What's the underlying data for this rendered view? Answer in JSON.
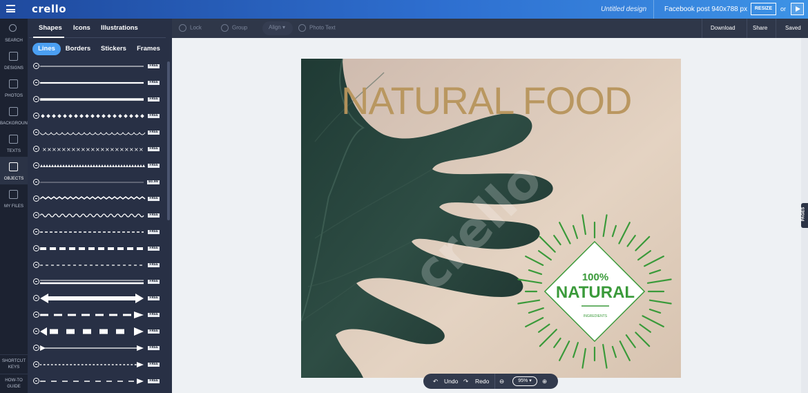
{
  "app": {
    "logo": "crello",
    "title": "Untitled design",
    "size_label": "Facebook post 940x788 px",
    "resize_label": "RESIZE",
    "or_label": "or"
  },
  "rail": {
    "items": [
      {
        "label": "SEARCH",
        "icon": "search-icon"
      },
      {
        "label": "DESIGNS",
        "icon": "designs-icon"
      },
      {
        "label": "PHOTOS",
        "icon": "photos-icon"
      },
      {
        "label": "BACKGROUND",
        "icon": "background-icon"
      },
      {
        "label": "TEXTS",
        "icon": "texts-icon"
      },
      {
        "label": "OBJECTS",
        "icon": "objects-icon"
      },
      {
        "label": "MY FILES",
        "icon": "my-files-icon"
      }
    ],
    "active": "OBJECTS",
    "shortcut_keys": "SHORTCUT KEYS",
    "how_to_guide": "HOW-TO GUIDE"
  },
  "panel": {
    "categories": [
      "Shapes",
      "Icons",
      "Illustrations"
    ],
    "active_category": "Shapes",
    "subtabs": [
      "Lines",
      "Borders",
      "Stickers",
      "Frames"
    ],
    "active_subtab": "Lines",
    "lines": [
      {
        "style": "thin",
        "badge": "FREE"
      },
      {
        "style": "medium",
        "badge": "FREE"
      },
      {
        "style": "thick",
        "badge": "FREE"
      },
      {
        "style": "diamonds",
        "badge": "FREE"
      },
      {
        "style": "scallop",
        "badge": "FREE"
      },
      {
        "style": "crosses",
        "badge": "FREE"
      },
      {
        "style": "triangles",
        "badge": "FREE"
      },
      {
        "style": "hairline",
        "badge": "$0.99"
      },
      {
        "style": "zigzag",
        "badge": "FREE"
      },
      {
        "style": "wave",
        "badge": "FREE"
      },
      {
        "style": "dashed-small",
        "badge": "FREE"
      },
      {
        "style": "dashed-bold",
        "badge": "FREE"
      },
      {
        "style": "dashed-thin",
        "badge": "FREE"
      },
      {
        "style": "double",
        "badge": "FREE"
      },
      {
        "style": "double-arrow",
        "badge": "FREE"
      },
      {
        "style": "dash-arrow",
        "badge": "FREE"
      },
      {
        "style": "block-arrow",
        "badge": "FREE"
      },
      {
        "style": "feather-arrow",
        "badge": "FREE"
      },
      {
        "style": "dotted-arrow",
        "badge": "FREE"
      },
      {
        "style": "dash-arrow-thin",
        "badge": "FREE"
      }
    ]
  },
  "toolbar": {
    "lock": "Lock",
    "group": "Group",
    "align": "Align",
    "photo_text": "Photo Text",
    "download": "Download",
    "share": "Share",
    "saved": "Saved"
  },
  "canvas": {
    "headline": "NATURAL FOOD",
    "badge_percent": "100%",
    "badge_word": "NATURAL",
    "badge_sub": "INGREDIENTS",
    "watermark": "crello",
    "headline_color": "#b8955c",
    "badge_color": "#3a9a3a"
  },
  "zoom": {
    "undo": "Undo",
    "redo": "Redo",
    "level": "95%"
  },
  "pages_tab": "PAGES"
}
